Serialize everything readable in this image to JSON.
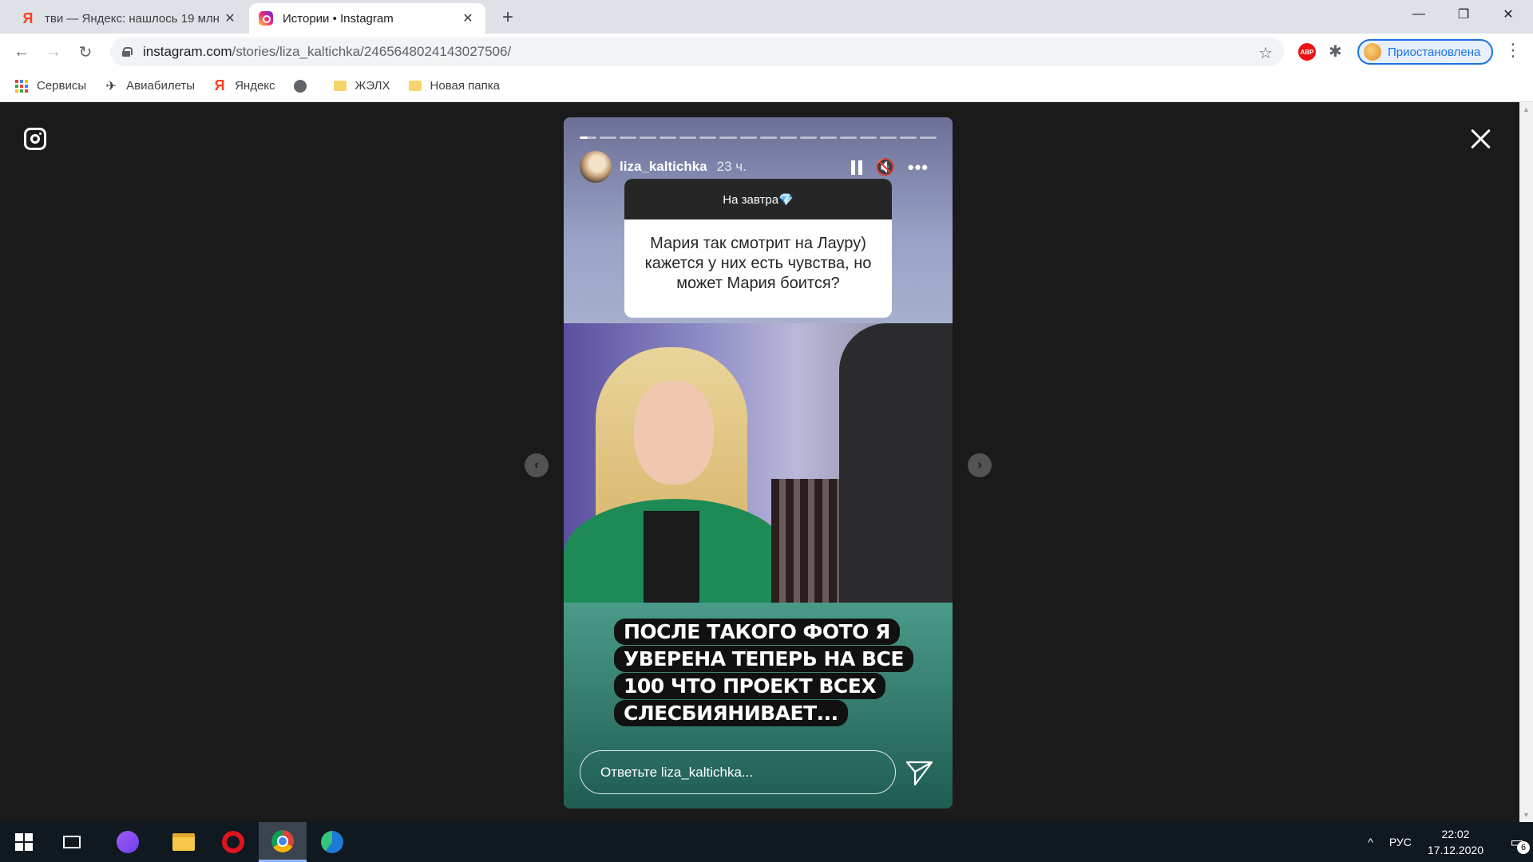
{
  "browser": {
    "tabs": [
      {
        "title": "тви — Яндекс: нашлось 19 млн",
        "icon": "yandex-favicon",
        "active": false
      },
      {
        "title": "Истории • Instagram",
        "icon": "instagram-favicon",
        "active": true
      }
    ],
    "new_tab": "+",
    "window_controls": {
      "minimize": "—",
      "maximize": "❐",
      "close": "✕"
    },
    "nav": {
      "back": "←",
      "forward": "→",
      "reload": "↻"
    },
    "url": {
      "host": "instagram.com",
      "path": "/stories/liza_kaltichka/2465648024143027506/"
    },
    "star": "☆",
    "extensions": {
      "abp": "ABP",
      "puzzle": "✱"
    },
    "profile": {
      "label": "Приостановлена"
    },
    "menu": "⋮",
    "bookmarks": [
      {
        "label": "Сервисы",
        "icon": "apps-grid-icon"
      },
      {
        "label": "Авиабилеты",
        "icon": "plane-icon"
      },
      {
        "label": "Яндекс",
        "icon": "yandex-icon"
      },
      {
        "label": "",
        "icon": "globe-icon"
      },
      {
        "label": "ЖЭЛХ",
        "icon": "folder-icon"
      },
      {
        "label": "Новая папка",
        "icon": "folder-icon"
      }
    ]
  },
  "story": {
    "progress_segments": 18,
    "progress_active_index": 0,
    "username": "liza_kaltichka",
    "time": "23 ч.",
    "question": {
      "header": "На завтра💎",
      "text": "Мария так смотрит на Лауру) кажется у них есть чувства, но может Мария боится?"
    },
    "caption": "ПОСЛЕ ТАКОГО ФОТО Я УВЕРЕНА ТЕПЕРЬ НА ВСЕ 100 ЧТО ПРОЕКТ ВСЕХ СЛЕСБИЯНИВАЕТ...",
    "reply_placeholder": "Ответьте liza_kaltichka...",
    "prev_arrow": "‹",
    "next_arrow": "›"
  },
  "taskbar": {
    "tray": {
      "language": "РУС",
      "time": "22:02",
      "date": "17.12.2020",
      "notifications": "6",
      "chevron": "^"
    }
  }
}
